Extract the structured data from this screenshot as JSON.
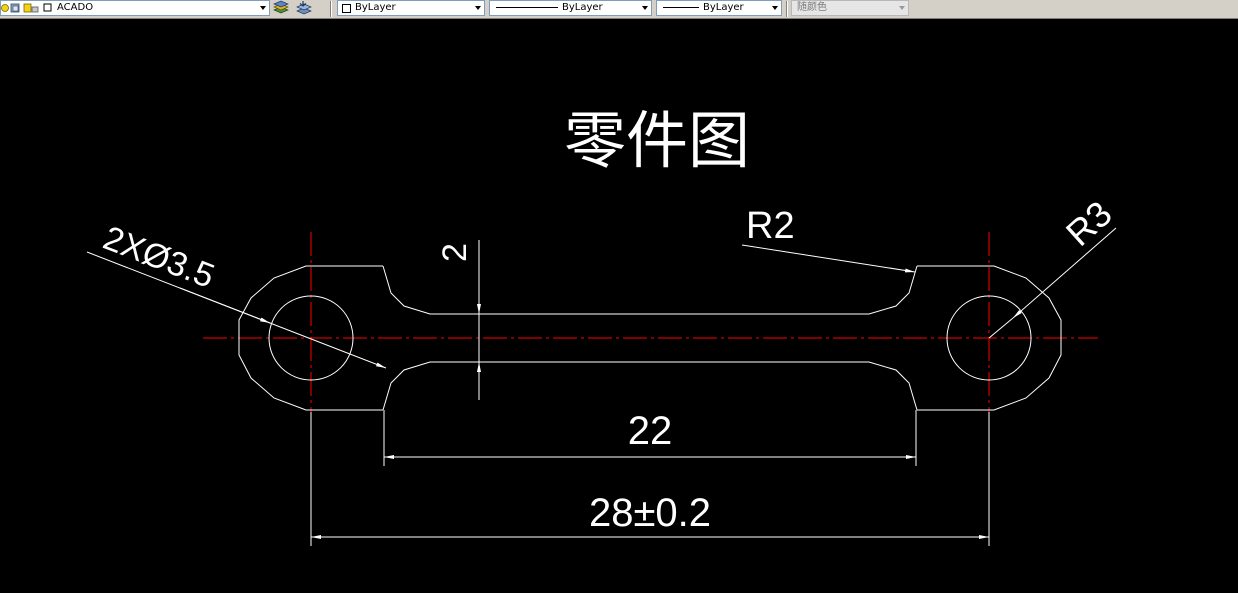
{
  "toolbar": {
    "layer_name": "ACADO",
    "color": "ByLayer",
    "linetype": "ByLayer",
    "lineweight": "ByLayer",
    "plotstyle": "随颜色"
  },
  "drawing": {
    "title": "零件图",
    "dimensions": {
      "hole": "2XØ3.5",
      "r2": "R2",
      "r3": "R3",
      "thickness": "2",
      "inner_length": "22",
      "overall_length": "28±0.2"
    }
  }
}
